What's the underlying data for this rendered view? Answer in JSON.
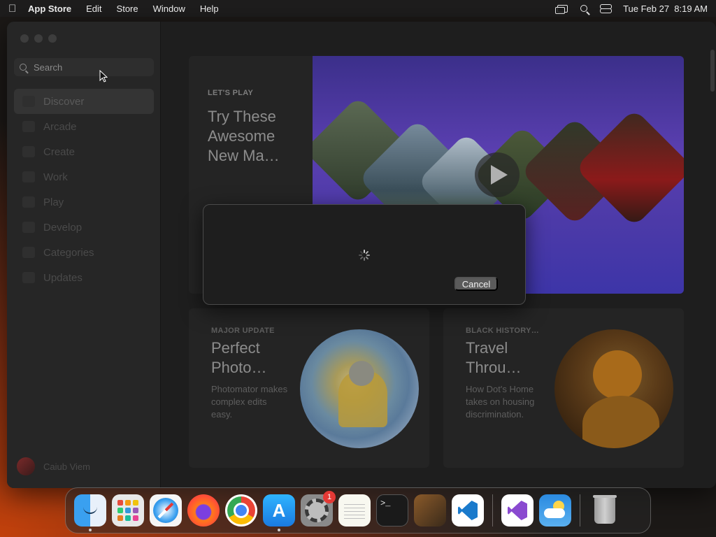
{
  "menubar": {
    "app_name": "App Store",
    "menus": [
      "Edit",
      "Store",
      "Window",
      "Help"
    ],
    "datetime": "Tue Feb 27  8:19 AM"
  },
  "sidebar": {
    "search_placeholder": "Search",
    "items": [
      {
        "label": "Discover",
        "icon": "star-icon"
      },
      {
        "label": "Arcade",
        "icon": "joystick-icon"
      },
      {
        "label": "Create",
        "icon": "brush-icon"
      },
      {
        "label": "Work",
        "icon": "paperplane-icon"
      },
      {
        "label": "Play",
        "icon": "rocket-icon"
      },
      {
        "label": "Develop",
        "icon": "hammer-icon"
      },
      {
        "label": "Categories",
        "icon": "grid-icon"
      },
      {
        "label": "Updates",
        "icon": "download-icon"
      }
    ],
    "user_name": "Caiub Viem"
  },
  "hero": {
    "eyebrow": "LET'S PLAY",
    "title": "Try These Awesome New Ma…"
  },
  "cards": [
    {
      "eyebrow": "MAJOR UPDATE",
      "title": "Perfect Photo…",
      "description": "Photomator makes complex edits easy."
    },
    {
      "eyebrow": "BLACK HISTORY…",
      "title": "Travel Throu…",
      "description": "How Dot's Home takes on housing discrimination."
    }
  ],
  "dialog": {
    "cancel_label": "Cancel"
  },
  "dock": {
    "settings_badge": "1",
    "items": [
      "Finder",
      "Launchpad",
      "Safari",
      "Firefox",
      "Chrome",
      "App Store",
      "System Settings",
      "TextEdit",
      "Terminal",
      "Instruments",
      "Visual Studio Code",
      "Visual Studio",
      "Weather",
      "Trash"
    ]
  }
}
